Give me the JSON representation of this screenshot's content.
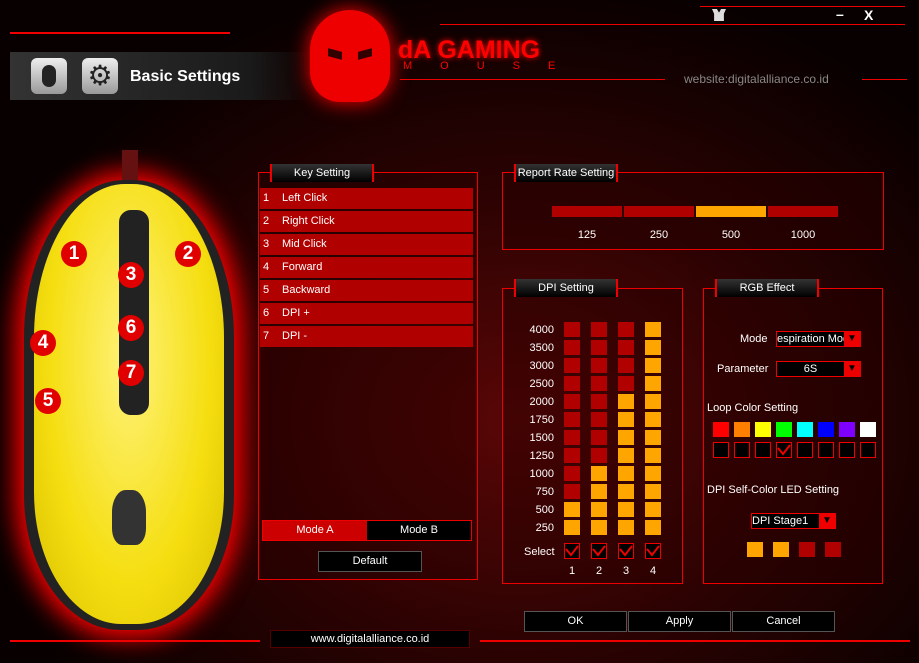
{
  "header": {
    "title": "Basic Settings",
    "brand": "dA GAMING",
    "brand_sub": "MOUSE",
    "website": "website:digitalalliance.co.id",
    "minimize": "–",
    "close": "X"
  },
  "footer": {
    "url": "www.digitalalliance.co.id"
  },
  "mouse": {
    "badges": [
      "1",
      "2",
      "3",
      "4",
      "5",
      "6",
      "7"
    ]
  },
  "key_setting": {
    "title": "Key Setting",
    "items": [
      {
        "n": "1",
        "label": "Left Click"
      },
      {
        "n": "2",
        "label": "Right Click"
      },
      {
        "n": "3",
        "label": "Mid Click"
      },
      {
        "n": "4",
        "label": "Forward"
      },
      {
        "n": "5",
        "label": "Backward"
      },
      {
        "n": "6",
        "label": "DPI +"
      },
      {
        "n": "7",
        "label": "DPI -"
      }
    ],
    "mode_a": "Mode A",
    "mode_b": "Mode B",
    "default": "Default",
    "active_mode": "Mode A"
  },
  "report_rate": {
    "title": "Report Rate Setting",
    "options": [
      "125",
      "250",
      "500",
      "1000"
    ],
    "selected": "500"
  },
  "dpi": {
    "title": "DPI Setting",
    "levels": [
      "4000",
      "3500",
      "3000",
      "2500",
      "2000",
      "1750",
      "1500",
      "1250",
      "1000",
      "750",
      "500",
      "250"
    ],
    "select_label": "Select",
    "columns": [
      {
        "n": "1",
        "value": 500,
        "selected": true
      },
      {
        "n": "2",
        "value": 1000,
        "selected": true
      },
      {
        "n": "3",
        "value": 2000,
        "selected": true
      },
      {
        "n": "4",
        "value": 4000,
        "selected": true
      }
    ]
  },
  "rgb": {
    "title": "RGB Effect",
    "mode_label": "Mode",
    "mode_value": "espiration Mod",
    "param_label": "Parameter",
    "param_value": "6S",
    "loop_label": "Loop Color Setting",
    "loop_colors": [
      "#ff0000",
      "#ff8000",
      "#ffff00",
      "#00ff00",
      "#00ffff",
      "#0000ff",
      "#8000ff",
      "#ffffff"
    ],
    "loop_checked": [
      false,
      false,
      false,
      true,
      false,
      false,
      false,
      false
    ],
    "led_label": "DPI Self-Color LED Setting",
    "led_stage": "DPI Stage1",
    "led_colors": [
      "#ffa500",
      "#ffa500",
      "#b00000",
      "#b00000"
    ]
  },
  "buttons": {
    "ok": "OK",
    "apply": "Apply",
    "cancel": "Cancel"
  },
  "colors": {
    "accent": "#e00000",
    "active": "#ffa500",
    "inactive": "#b00000"
  }
}
